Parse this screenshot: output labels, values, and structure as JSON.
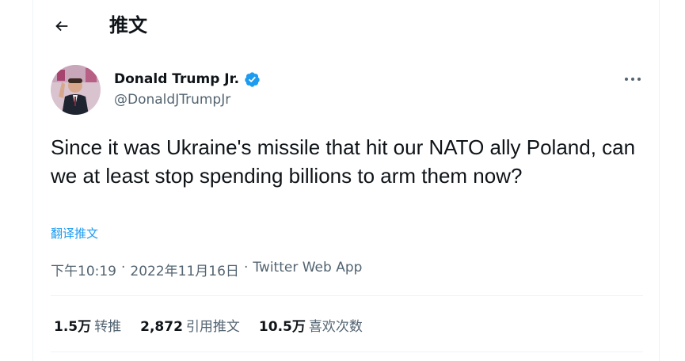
{
  "header": {
    "back_icon": "arrow-left-icon",
    "title": "推文"
  },
  "author": {
    "name": "Donald Trump Jr.",
    "handle": "@DonaldJTrumpJr",
    "verified_icon": "verified-badge-icon",
    "verified_color": "#1d9bf0"
  },
  "more_icon": "more-horizontal-icon",
  "tweet": {
    "text": "Since it was Ukraine's missile that hit our NATO ally Poland, can we at least stop spending billions to arm them now?",
    "translate_label": "翻译推文"
  },
  "meta": {
    "time": "下午10:19",
    "separator": "·",
    "date": "2022年11月16日",
    "source": "Twitter Web App"
  },
  "stats": [
    {
      "count": "1.5万",
      "label": "转推"
    },
    {
      "count": "2,872",
      "label": "引用推文"
    },
    {
      "count": "10.5万",
      "label": "喜欢次数"
    }
  ],
  "colors": {
    "accent": "#1d9bf0",
    "text_primary": "#0f1419",
    "text_secondary": "#536471",
    "divider": "#eff3f4"
  }
}
